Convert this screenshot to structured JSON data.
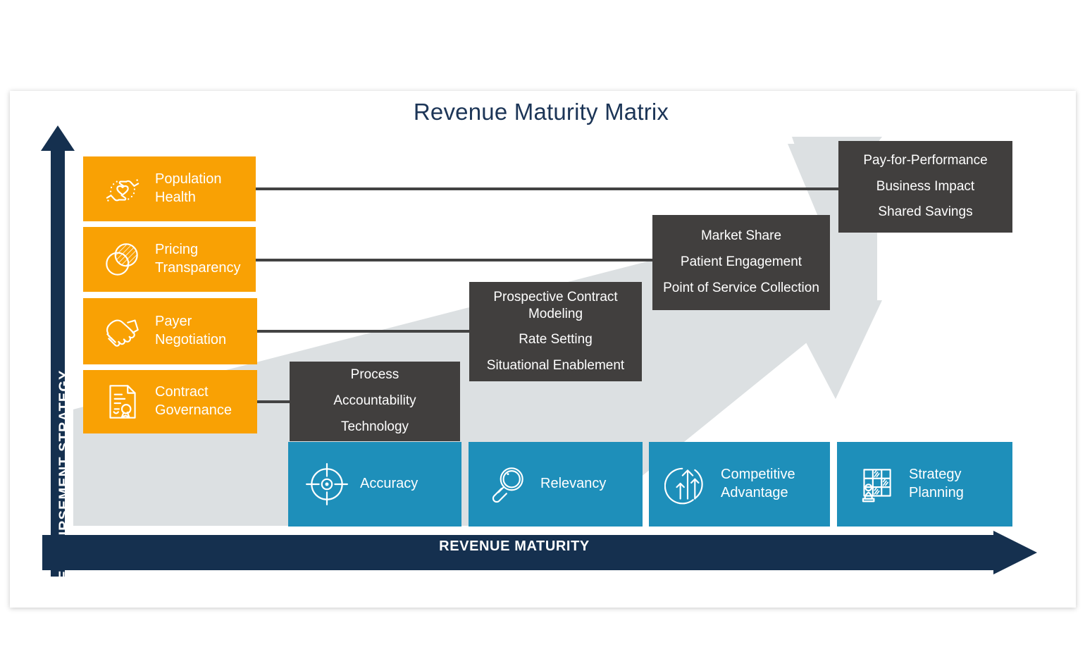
{
  "page": {
    "title": "Revenue Maturity Matrix",
    "background": "#ffffff"
  },
  "colors": {
    "navy": "#15304F",
    "orange": "#F9A104",
    "blue": "#1E8FBA",
    "dark_gray": "#413F3E",
    "band_gray": "#DCE0E2",
    "connector": "#434343",
    "title_text": "#1c3557"
  },
  "axes": {
    "y": {
      "label": "REIMBURSEMENT STRATEGY",
      "direction": "up"
    },
    "x": {
      "label": "REVENUE MATURITY",
      "direction": "right"
    }
  },
  "strategy_rows": [
    {
      "icon": "population-health-icon",
      "label": "Population\nHealth"
    },
    {
      "icon": "pricing-transparency-icon",
      "label": "Pricing\nTransparency"
    },
    {
      "icon": "payer-negotiation-icon",
      "label": "Payer\nNegotiation"
    },
    {
      "icon": "contract-governance-icon",
      "label": "Contract\nGovernance"
    }
  ],
  "maturity_stages": [
    {
      "icon": "target-icon",
      "label": "Accuracy"
    },
    {
      "icon": "magnifier-icon",
      "label": "Relevancy"
    },
    {
      "icon": "growth-arrows-icon",
      "label": "Competitive\nAdvantage"
    },
    {
      "icon": "chess-grid-icon",
      "label": "Strategy\nPlanning"
    }
  ],
  "outcome_boxes": [
    {
      "name": "stage-1-outcomes",
      "lines": [
        "Process",
        "Accountability",
        "Technology"
      ]
    },
    {
      "name": "stage-2-outcomes",
      "lines": [
        "Prospective Contract Modeling",
        "Rate Setting",
        "Situational Enablement"
      ]
    },
    {
      "name": "stage-3-outcomes",
      "lines": [
        "Market Share",
        "Patient Engagement",
        "Point of Service Collection"
      ]
    },
    {
      "name": "stage-4-outcomes",
      "lines": [
        "Pay-for-Performance",
        "Business Impact",
        "Shared Savings"
      ]
    }
  ]
}
